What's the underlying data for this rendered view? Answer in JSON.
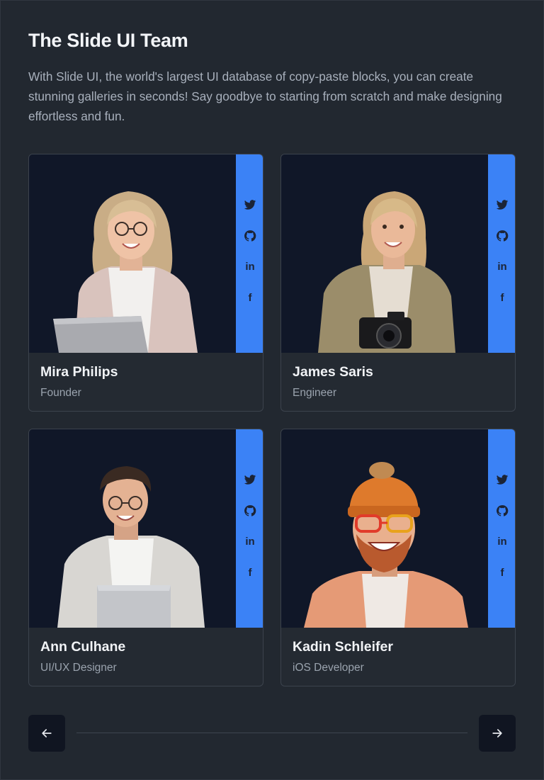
{
  "header": {
    "title": "The Slide UI Team",
    "description": "With Slide UI, the world's largest UI database of copy-paste blocks, you can create stunning galleries in seconds! Say goodbye to starting from scratch and make designing effortless and fun."
  },
  "team": [
    {
      "name": "Mira Philips",
      "role": "Founder",
      "avatar": "woman-laptop"
    },
    {
      "name": "James Saris",
      "role": "Engineer",
      "avatar": "woman-camera"
    },
    {
      "name": "Ann Culhane",
      "role": "UI/UX Designer",
      "avatar": "man-laptop"
    },
    {
      "name": "Kadin Schleifer",
      "role": "iOS Developer",
      "avatar": "man-beanie"
    }
  ],
  "socials": {
    "twitter_icon": "twitter-icon",
    "github_icon": "github-icon",
    "linkedin_label": "in",
    "facebook_label": "f"
  },
  "navigation": {
    "prev_icon": "arrow-left-icon",
    "next_icon": "arrow-right-icon"
  },
  "colors": {
    "background": "#222830",
    "photo_bg": "#101728",
    "social_rail": "#3b82f6"
  }
}
